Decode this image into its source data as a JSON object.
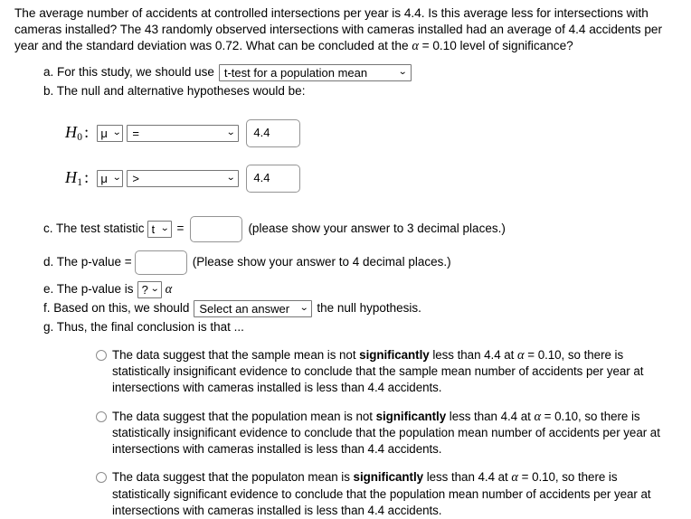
{
  "prompt": {
    "text_part1": "The average number of accidents at controlled intersections per year is 4.4.  Is this average less for intersections with cameras installed? The 43 randomly observed intersections with cameras installed had an average of 4.4 accidents per year and the standard deviation was 0.72. What can be concluded at the ",
    "alpha_symbol": "α",
    "text_part2": " = 0.10 level of significance?"
  },
  "items": {
    "a": {
      "label": "a. For this study, we should use",
      "method_select": {
        "value": "t-test for a population mean",
        "caret": "chevron-down-icon"
      }
    },
    "b": {
      "label": "b. The null and alternative hypotheses would be:"
    },
    "h0": {
      "name": "H",
      "sub": "0",
      "colon": ":",
      "param_select": "μ",
      "operator_select": "=",
      "value": "4.4"
    },
    "h1": {
      "name": "H",
      "sub": "1",
      "colon": ":",
      "param_select": "μ",
      "operator_select": ">",
      "value": "4.4"
    },
    "c": {
      "label": "c. The test statistic",
      "stat_select": "t",
      "equals": "=",
      "input_value": "",
      "note": "(please show your answer to 3 decimal places.)"
    },
    "d": {
      "label": "d. The p-value =",
      "input_value": "",
      "note": "(Please show your answer to 4 decimal places.)"
    },
    "e": {
      "label": "e. The p-value is",
      "comparison_select": "?",
      "alpha_symbol": "α"
    },
    "f": {
      "label_before": "f. Based on this, we should",
      "answer_select": "Select an answer",
      "label_after": "the null hypothesis."
    },
    "g": {
      "label": "g. Thus, the final conclusion is that ..."
    }
  },
  "options": [
    {
      "part1": "The data suggest that the sample mean is not ",
      "bold": "significantly",
      "part2": " less than 4.4 at ",
      "alpha": "α",
      "part3": " = 0.10, so there is statistically insignificant evidence to conclude that the sample mean number of accidents per year at intersections with cameras installed is less than 4.4 accidents.",
      "selected": false
    },
    {
      "part1": "The data suggest that the population mean is not ",
      "bold": "significantly",
      "part2": " less than 4.4 at ",
      "alpha": "α",
      "part3": " = 0.10, so there is statistically insignificant evidence to conclude that the population mean number of accidents per year at intersections with cameras installed is less than 4.4 accidents.",
      "selected": false
    },
    {
      "part1": "The data suggest that the populaton mean is ",
      "bold": "significantly",
      "part2": " less than 4.4 at ",
      "alpha": "α",
      "part3": " = 0.10, so there is statistically significant evidence to conclude that the population mean number of accidents per year at intersections with cameras installed is less than 4.4 accidents.",
      "selected": false
    }
  ],
  "colors": {
    "background": "#ffffff",
    "text": "#000000",
    "select_border": "#767676",
    "input_border": "#949494",
    "radio_border": "#8c8c8c"
  }
}
